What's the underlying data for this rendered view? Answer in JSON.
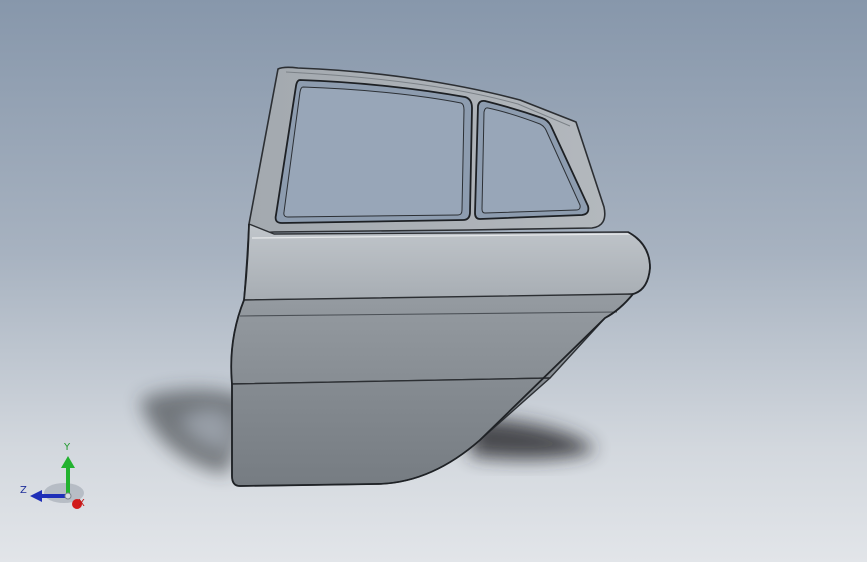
{
  "viewport": {
    "background": "gradient-blue-gray",
    "model": "rear-car-door"
  },
  "triad": {
    "x_label": "X",
    "y_label": "Y",
    "z_label": "Z",
    "colors": {
      "x": "#d11a1a",
      "y": "#22b22f",
      "z": "#1f2fb8"
    }
  }
}
